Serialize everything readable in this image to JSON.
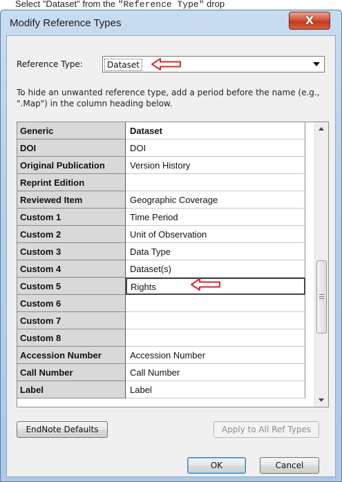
{
  "caption": {
    "prefix": "Select \"Dataset\" from the ",
    "code": "\"Reference Type\"",
    "suffix": " drop"
  },
  "dialog": {
    "title": "Modify Reference Types",
    "close_glyph": "X"
  },
  "reference_type": {
    "label": "Reference Type:",
    "selected": "Dataset"
  },
  "instructions": "To hide an unwanted reference type, add a period before the name (e.g., \".Map\") in the column heading below.",
  "grid": {
    "rows": [
      {
        "generic": "Generic",
        "value": "Dataset"
      },
      {
        "generic": "DOI",
        "value": "DOI"
      },
      {
        "generic": "Original Publication",
        "value": "Version History"
      },
      {
        "generic": "Reprint Edition",
        "value": ""
      },
      {
        "generic": "Reviewed Item",
        "value": "Geographic Coverage"
      },
      {
        "generic": "Custom 1",
        "value": "Time Period"
      },
      {
        "generic": "Custom 2",
        "value": "Unit of Observation"
      },
      {
        "generic": "Custom 3",
        "value": "Data Type"
      },
      {
        "generic": "Custom 4",
        "value": "Dataset(s)"
      },
      {
        "generic": "Custom 5",
        "value": "Rights"
      },
      {
        "generic": "Custom 6",
        "value": ""
      },
      {
        "generic": "Custom 7",
        "value": ""
      },
      {
        "generic": "Custom 8",
        "value": ""
      },
      {
        "generic": "Accession Number",
        "value": "Accession Number"
      },
      {
        "generic": "Call Number",
        "value": "Call Number"
      },
      {
        "generic": "Label",
        "value": "Label"
      }
    ]
  },
  "buttons": {
    "defaults": "EndNote Defaults",
    "apply_all": "Apply to All Ref Types",
    "ok": "OK",
    "cancel": "Cancel"
  },
  "colors": {
    "annotation_arrow": "#d9262c",
    "close_button": "#c73b1f"
  }
}
